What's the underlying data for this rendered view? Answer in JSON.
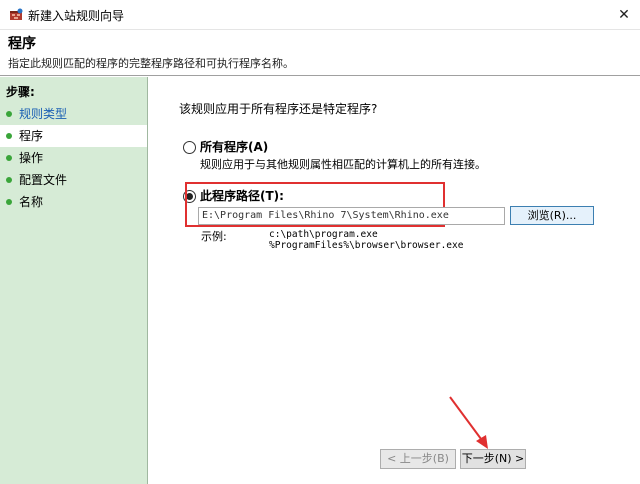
{
  "window": {
    "title": "新建入站规则向导",
    "close_glyph": "✕"
  },
  "header": {
    "heading": "程序",
    "description": "指定此规则匹配的程序的完整程序路径和可执行程序名称。"
  },
  "sidebar": {
    "title": "步骤:",
    "items": [
      {
        "label": "规则类型",
        "state": "done"
      },
      {
        "label": "程序",
        "state": "active"
      },
      {
        "label": "操作",
        "state": "pending"
      },
      {
        "label": "配置文件",
        "state": "pending"
      },
      {
        "label": "名称",
        "state": "pending"
      }
    ]
  },
  "main": {
    "question": "该规则应用于所有程序还是特定程序?",
    "all_programs": {
      "label": "所有程序(A)",
      "description": "规则应用于与其他规则属性相匹配的计算机上的所有连接。",
      "checked": false
    },
    "this_program": {
      "label": "此程序路径(T):",
      "checked": true,
      "path_value": "E:\\Program Files\\Rhino 7\\System\\Rhino.exe",
      "browse_label": "浏览(R)..."
    },
    "example": {
      "label": "示例:",
      "lines": [
        "c:\\path\\program.exe",
        "%ProgramFiles%\\browser\\browser.exe"
      ]
    }
  },
  "nav": {
    "back_label": "< 上一步(B)",
    "next_label": "下一步(N) >"
  },
  "colors": {
    "sidebar_bg": "#d6ebd6",
    "highlight": "#e03030",
    "accent": "#3c7fb1"
  }
}
